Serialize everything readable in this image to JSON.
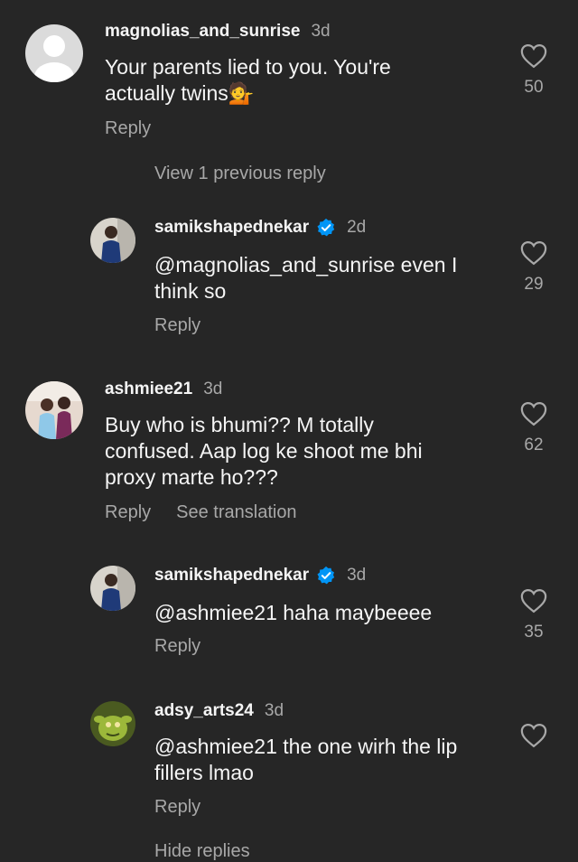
{
  "comments": [
    {
      "username": "magnolias_and_sunrise",
      "time": "3d",
      "text": "Your parents lied to you. You're actually twins💁",
      "lines": [
        "Your parents lied to you. You're",
        "actually twins💁"
      ],
      "actions": [
        "Reply"
      ],
      "likes": "50",
      "avatar": "default-avatar",
      "verified": false
    },
    {
      "username": "samikshapednekar",
      "time": "2d",
      "lines": [
        "@magnolias_and_sunrise even I",
        "think so"
      ],
      "actions": [
        "Reply"
      ],
      "likes": "29",
      "avatar": "profile-photo",
      "verified": true
    },
    {
      "username": "ashmiee21",
      "time": "3d",
      "lines": [
        "Buy who is bhumi?? M totally",
        "confused. Aap log ke shoot me bhi",
        "proxy marte ho???"
      ],
      "actions": [
        "Reply",
        "See translation"
      ],
      "likes": "62",
      "avatar": "profile-photo",
      "verified": false
    },
    {
      "username": "samikshapednekar",
      "time": "3d",
      "lines": [
        "@ashmiee21 haha maybeeee"
      ],
      "actions": [
        "Reply"
      ],
      "likes": "35",
      "avatar": "profile-photo",
      "verified": true
    },
    {
      "username": "adsy_arts24",
      "time": "3d",
      "lines": [
        "@ashmiee21 the one wirh the lip",
        "fillers lmao"
      ],
      "actions": [
        "Reply"
      ],
      "likes": "",
      "avatar": "profile-photo",
      "verified": false
    }
  ],
  "view_previous": "View 1 previous reply",
  "hide_replies": "Hide replies",
  "colors": {
    "background": "#262626",
    "text": "#f5f5f5",
    "secondary": "#a8a8a8",
    "verified": "#0095f6"
  }
}
